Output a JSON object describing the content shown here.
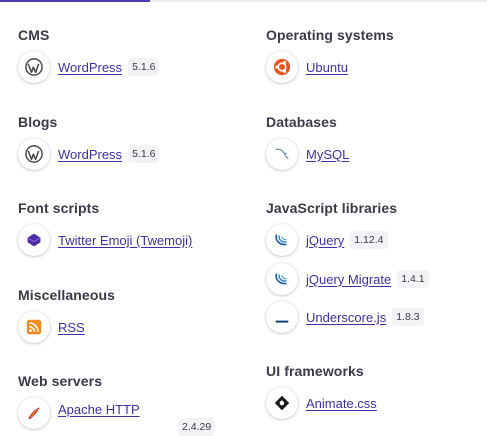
{
  "left_column": [
    {
      "category": "CMS",
      "items": [
        {
          "name": "WordPress",
          "version": "5.1.6",
          "icon": "wordpress-icon"
        }
      ]
    },
    {
      "category": "Blogs",
      "items": [
        {
          "name": "WordPress",
          "version": "5.1.6",
          "icon": "wordpress-icon"
        }
      ]
    },
    {
      "category": "Font scripts",
      "items": [
        {
          "name": "Twitter Emoji (Twemoji)",
          "version": "",
          "icon": "twemoji-icon"
        }
      ]
    },
    {
      "category": "Miscellaneous",
      "items": [
        {
          "name": "RSS",
          "version": "",
          "icon": "rss-icon"
        }
      ]
    },
    {
      "category": "Web servers",
      "items": [
        {
          "name": "Apache HTTP",
          "version": "2.4.29",
          "icon": "apache-icon"
        }
      ]
    }
  ],
  "right_column": [
    {
      "category": "Operating systems",
      "items": [
        {
          "name": "Ubuntu",
          "version": "",
          "icon": "ubuntu-icon"
        }
      ]
    },
    {
      "category": "Databases",
      "items": [
        {
          "name": "MySQL",
          "version": "",
          "icon": "mysql-icon"
        }
      ]
    },
    {
      "category": "JavaScript libraries",
      "items": [
        {
          "name": "jQuery",
          "version": "1.12.4",
          "icon": "jquery-icon"
        },
        {
          "name": "jQuery Migrate",
          "version": "1.4.1",
          "icon": "jquery-icon"
        },
        {
          "name": "Underscore.js",
          "version": "1.8.3",
          "icon": "underscore-icon"
        }
      ]
    },
    {
      "category": "UI frameworks",
      "items": [
        {
          "name": "Animate.css",
          "version": "",
          "icon": "animate-css-icon"
        }
      ]
    }
  ],
  "colors": {
    "link": "#3f2fa8",
    "active_tab": "#4a3bb0",
    "heading": "#3a3a48"
  }
}
